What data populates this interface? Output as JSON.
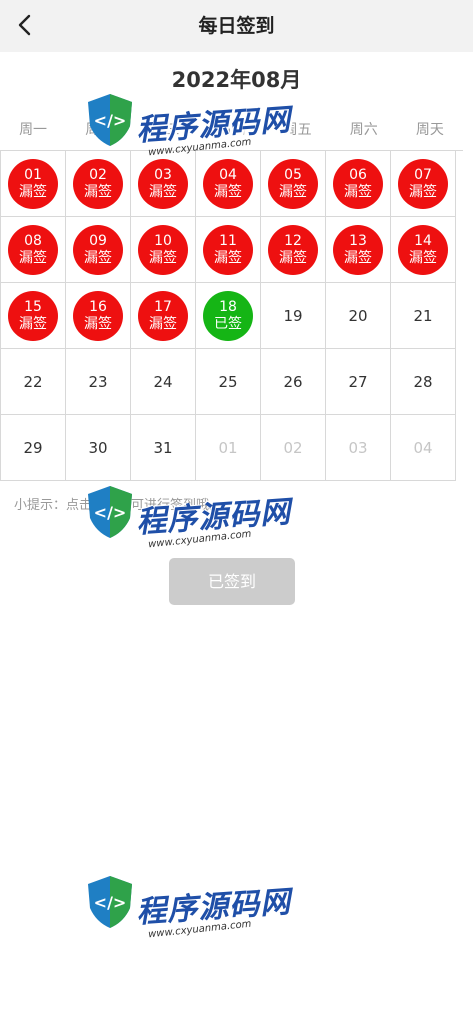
{
  "header": {
    "title": "每日签到",
    "back_icon": "chevron-left-icon"
  },
  "calendar": {
    "month_title": "2022年08月",
    "weekdays": [
      "周一",
      "周二",
      "周三",
      "周四",
      "周五",
      "周六",
      "周天"
    ],
    "days": [
      {
        "day": "01",
        "status": "漏签",
        "type": "missed"
      },
      {
        "day": "02",
        "status": "漏签",
        "type": "missed"
      },
      {
        "day": "03",
        "status": "漏签",
        "type": "missed"
      },
      {
        "day": "04",
        "status": "漏签",
        "type": "missed"
      },
      {
        "day": "05",
        "status": "漏签",
        "type": "missed"
      },
      {
        "day": "06",
        "status": "漏签",
        "type": "missed"
      },
      {
        "day": "07",
        "status": "漏签",
        "type": "missed"
      },
      {
        "day": "08",
        "status": "漏签",
        "type": "missed"
      },
      {
        "day": "09",
        "status": "漏签",
        "type": "missed"
      },
      {
        "day": "10",
        "status": "漏签",
        "type": "missed"
      },
      {
        "day": "11",
        "status": "漏签",
        "type": "missed"
      },
      {
        "day": "12",
        "status": "漏签",
        "type": "missed"
      },
      {
        "day": "13",
        "status": "漏签",
        "type": "missed"
      },
      {
        "day": "14",
        "status": "漏签",
        "type": "missed"
      },
      {
        "day": "15",
        "status": "漏签",
        "type": "missed"
      },
      {
        "day": "16",
        "status": "漏签",
        "type": "missed"
      },
      {
        "day": "17",
        "status": "漏签",
        "type": "missed"
      },
      {
        "day": "18",
        "status": "已签",
        "type": "signed"
      },
      {
        "day": "19",
        "status": "",
        "type": "normal"
      },
      {
        "day": "20",
        "status": "",
        "type": "normal"
      },
      {
        "day": "21",
        "status": "",
        "type": "normal"
      },
      {
        "day": "22",
        "status": "",
        "type": "normal"
      },
      {
        "day": "23",
        "status": "",
        "type": "normal"
      },
      {
        "day": "24",
        "status": "",
        "type": "normal"
      },
      {
        "day": "25",
        "status": "",
        "type": "normal"
      },
      {
        "day": "26",
        "status": "",
        "type": "normal"
      },
      {
        "day": "27",
        "status": "",
        "type": "normal"
      },
      {
        "day": "28",
        "status": "",
        "type": "normal"
      },
      {
        "day": "29",
        "status": "",
        "type": "normal"
      },
      {
        "day": "30",
        "status": "",
        "type": "normal"
      },
      {
        "day": "31",
        "status": "",
        "type": "normal"
      },
      {
        "day": "01",
        "status": "",
        "type": "other"
      },
      {
        "day": "02",
        "status": "",
        "type": "other"
      },
      {
        "day": "03",
        "status": "",
        "type": "other"
      },
      {
        "day": "04",
        "status": "",
        "type": "other"
      }
    ]
  },
  "tip": {
    "text": "小提示：点击按钮即可进行签到哦。"
  },
  "sign_button": {
    "label": "已签到"
  },
  "watermark": {
    "text": "程序源码网",
    "url": "www.cxyuanma.com"
  },
  "colors": {
    "missed": "#ee1010",
    "signed": "#15b515",
    "button_disabled": "#cccccc",
    "header_bg": "#f2f2f2"
  }
}
